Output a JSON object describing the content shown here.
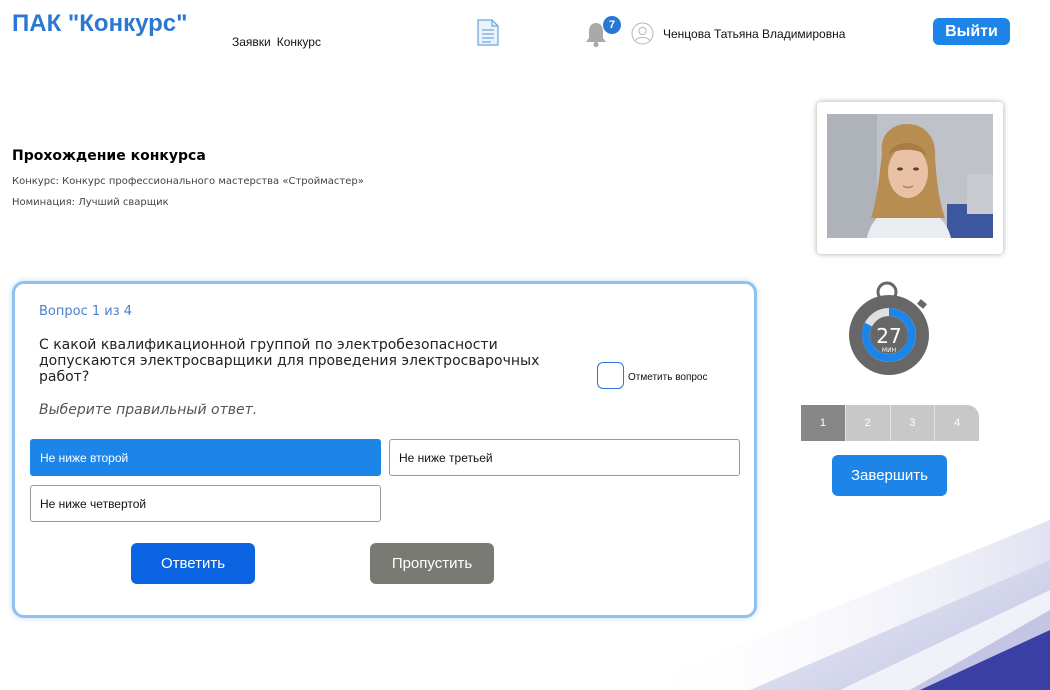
{
  "header": {
    "logo": "ПАК \"Конкурс\"",
    "nav": [
      "Заявки",
      "Конкурс"
    ],
    "notifications_count": "7",
    "user_name": "Ченцова Татьяна Владимировна",
    "logout_label": "Выйти"
  },
  "info": {
    "title": "Прохождение конкурса",
    "contest": "Конкурс: Конкурс профессионального мастерства «Строймастер»",
    "nomination": "Номинация: Лучший сварщик"
  },
  "timer": {
    "value": "27",
    "unit": "МИН"
  },
  "pagination": {
    "pages": [
      "1",
      "2",
      "3",
      "4"
    ],
    "active": "1"
  },
  "finish_label": "Завершить",
  "question": {
    "counter": "Вопрос 1 из 4",
    "text": "С какой квалификационной группой по электробезопасности допускаются электросварщики для проведения электросварочных работ?",
    "hint": "Выберите правильный ответ.",
    "mark_label": "Отметить вопрос",
    "answers": [
      "Не ниже второй",
      "Не ниже третьей",
      "Не ниже четвертой"
    ],
    "selected_answer": "Не ниже второй",
    "answer_label": "Ответить",
    "skip_label": "Пропустить"
  },
  "icons": {
    "document": "document-icon",
    "notifications": "bell-icon",
    "user": "user-avatar-icon",
    "timer": "stopwatch-icon"
  },
  "colors": {
    "brand": "#2b78d4",
    "primary_button": "#1e85e8",
    "answer_button": "#0a63e0",
    "skip_button": "#7a7a74",
    "card_border": "#8fc2f0"
  }
}
